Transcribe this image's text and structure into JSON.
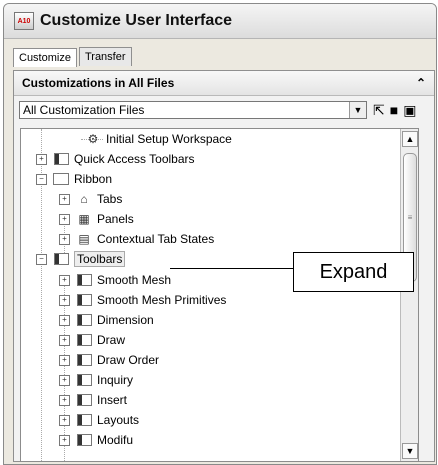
{
  "window": {
    "title": "Customize User Interface",
    "icon_label": "A10"
  },
  "tabs": [
    {
      "label": "Customize",
      "active": true
    },
    {
      "label": "Transfer",
      "active": false
    }
  ],
  "panel": {
    "title": "Customizations in All Files",
    "collapse_icon": "double-chevron-up-icon"
  },
  "file_selector": {
    "value": "All Customization Files"
  },
  "toolbar_icons": [
    "open-icon",
    "save-icon",
    "load-icon"
  ],
  "tree": {
    "items": [
      {
        "label": "Initial Setup Workspace"
      },
      {
        "label": "Quick Access Toolbars"
      },
      {
        "label": "Ribbon"
      },
      {
        "label": "Tabs"
      },
      {
        "label": "Panels"
      },
      {
        "label": "Contextual Tab States"
      },
      {
        "label": "Toolbars"
      },
      {
        "label": "Smooth Mesh"
      },
      {
        "label": "Smooth Mesh Primitives"
      },
      {
        "label": "Dimension"
      },
      {
        "label": "Draw"
      },
      {
        "label": "Draw Order"
      },
      {
        "label": "Inquiry"
      },
      {
        "label": "Insert"
      },
      {
        "label": "Layouts"
      },
      {
        "label": "Modifu"
      }
    ]
  },
  "callout": {
    "text": "Expand"
  }
}
